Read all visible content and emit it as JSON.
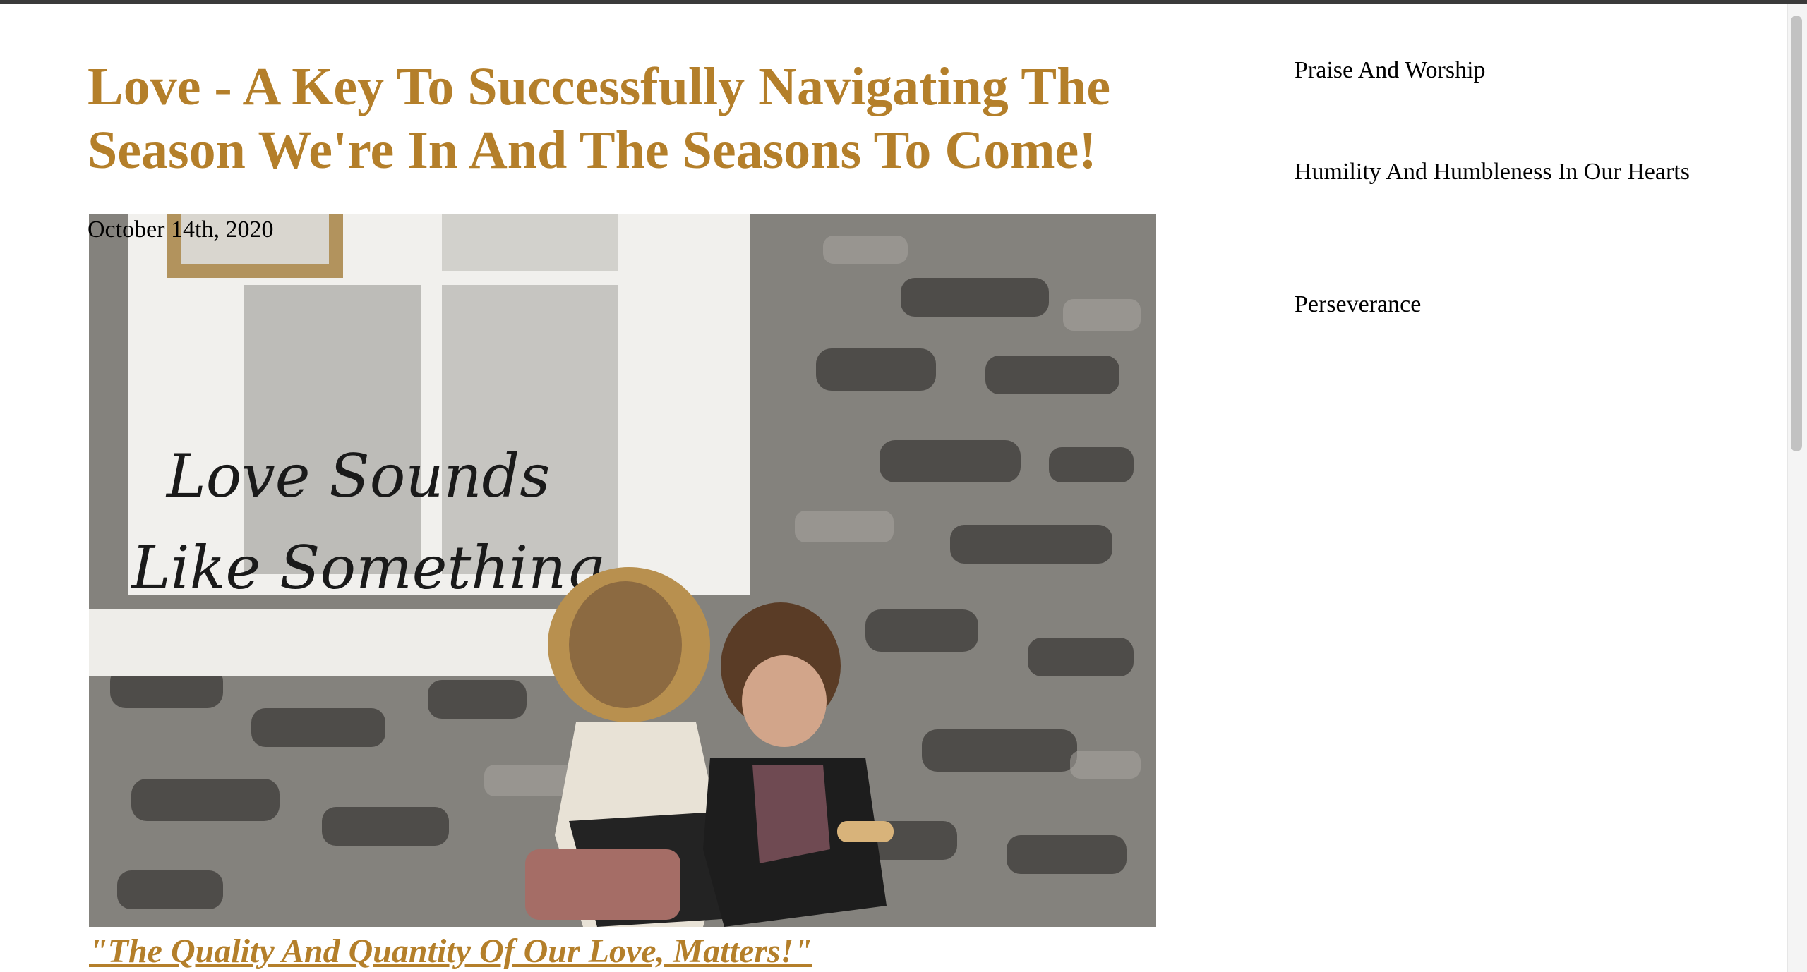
{
  "post": {
    "title": "Love - A Key To Successfully Navigating The Season We're In And The Seasons To Come!",
    "date": "October 14th, 2020",
    "image_text": {
      "line1": "Love Sounds",
      "line2": "Like Something"
    },
    "caption_link": "\"The Quality And Quantity Of Our Love, Matters!\""
  },
  "sidebar": {
    "items": [
      {
        "label": "Praise And Worship"
      },
      {
        "label": "Humility And Humbleness In Our Hearts"
      },
      {
        "label": "Perseverance"
      }
    ]
  },
  "colors": {
    "accent": "#b47f2a",
    "text": "#000000",
    "background": "#ffffff"
  }
}
